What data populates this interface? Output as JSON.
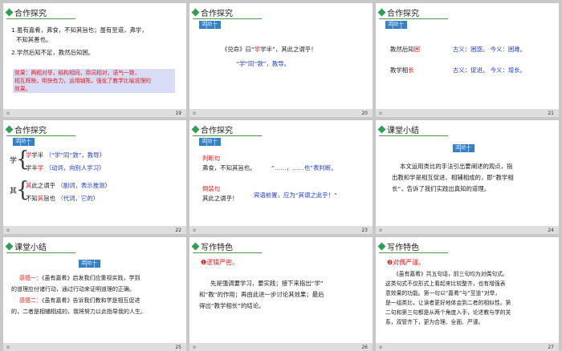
{
  "slides": [
    {
      "number": "19",
      "header": "合作探究",
      "lines": [
        "1.虽有嘉肴，弗食，不知其旨也；虽有至道，弗学，",
        "不知其善也。",
        "2.学然后知不足，教然后知困。"
      ],
      "note_label": "效果：",
      "note_text": [
        "两相对举，结构相同，用词相对，语气一致，",
        "相互辉映，明快有力，运用铺陈，强化了教学比喻说理的",
        "效果。"
      ]
    },
    {
      "number": "20",
      "header": "合作探究",
      "line1_pre": "《兑命》曰“",
      "line1_red": "学",
      "line1_mid": "学半”，其此之谓乎！",
      "line2_blue": "“学”同“敩”，教导。"
    },
    {
      "number": "21",
      "header": "合作探究",
      "row1_pre": "教然后知",
      "row1_red": "困",
      "row1_blue": "古义：困惑。    今义：困难。",
      "row2_pre": "教学相",
      "row2_red": "长",
      "row2_blue": "古义：促进。    今义：增长。"
    },
    {
      "number": "22",
      "header": "合作探究",
      "xue": "学",
      "qi": "其",
      "r1_red": "学",
      "r1_black": "学半",
      "r1_blue": "（“学”同“敩”，教导",
      "r1_end": "）",
      "r2_red": "学",
      "r2_black": "学半",
      "r2_blue": "（动词，向别人学习",
      "r2_end": "）",
      "r3_red": "其",
      "r3_black": "此之谓乎",
      "r3_blue": "（副词，表示推测",
      "r3_end": "）",
      "r4_black1": "不知",
      "r4_red": "其",
      "r4_black2": "旨也",
      "r4_blue": "（代词，它的",
      "r4_end": "）"
    },
    {
      "number": "23",
      "header": "合作探究",
      "label1": "判断句",
      "sent1": "弗食，不知其旨也。",
      "expl1": "“……，……也”表判断。",
      "label2": "倒装句",
      "sent2": "其此之谓乎！",
      "expl2": "宾语前置，应为“其谓之此乎！”"
    },
    {
      "number": "24",
      "header": "课堂小结",
      "text": [
        "本文运用类比的手法引出要阐述的观点，指",
        "出教和学是相互促进、相辅相成的，即“教学相",
        "长”，告诉了我们实践出真知的道理。"
      ]
    },
    {
      "number": "25",
      "header": "课堂小结",
      "l1_red": "感悟一：",
      "l1": "《虽有嘉肴》启发我们应重视实践，学到",
      "l2": "的道理应付诸行动，通过行动来证明道理的正确。",
      "l3_red": "感悟二：",
      "l3": "《虽有嘉肴》告诉我们教和学是相互促进",
      "l4": "的，二者是相辅相成的，我将努力以此指导我的人生。"
    },
    {
      "number": "26",
      "header": "写作特色",
      "sub": "❶逻辑严密。",
      "text": [
        "先是强调要学习，要实践；接下来指出“学”",
        "和“教”的作用；再由此进一步讨论其效果；最后",
        "得出“教学相长”的结论。"
      ]
    },
    {
      "number": "27",
      "header": "写作特色",
      "sub": "❷对偶严谨。",
      "text": [
        "《虽有嘉肴》共五句话，前三句均为对偶句式。",
        "这类句式不仅形式上看起来比较整齐，也有增强表",
        "意效果的功能。第一句以“嘉肴”与“至道”对举，",
        "是一组类比，让读者更好地体会到二者的相似性。第",
        "二句和第三句都是从两个角度入手，论述教与学的关",
        "系，双管齐下，更为合理、全面、严谨。"
      ]
    }
  ],
  "badge_text": "活动一"
}
